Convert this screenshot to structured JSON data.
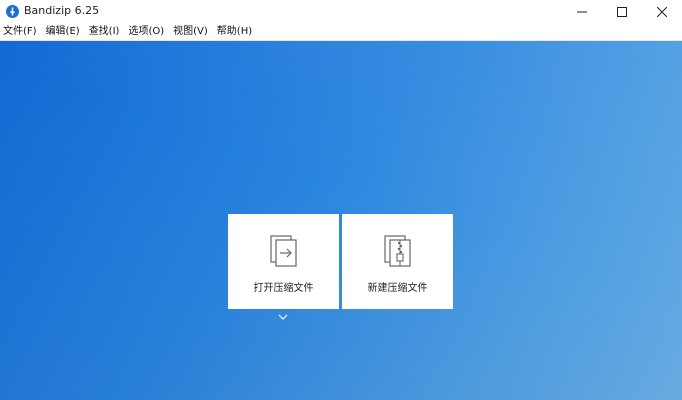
{
  "window": {
    "title": "Bandizip 6.25",
    "icons": [
      "bandizip-app-icon",
      "minimize-icon",
      "maximize-icon",
      "close-icon"
    ]
  },
  "menu": {
    "items": [
      {
        "label": "文件(F)"
      },
      {
        "label": "编辑(E)"
      },
      {
        "label": "查找(I)"
      },
      {
        "label": "选项(O)"
      },
      {
        "label": "视图(V)"
      },
      {
        "label": "帮助(H)"
      }
    ]
  },
  "main": {
    "background_gradient": [
      "#1168d4",
      "#6aaee3"
    ],
    "actions": [
      {
        "label": "打开压缩文件",
        "icon": "open-archive-icon"
      },
      {
        "label": "新建压缩文件",
        "icon": "new-archive-icon"
      }
    ],
    "more_icon": "chevron-down-icon"
  }
}
